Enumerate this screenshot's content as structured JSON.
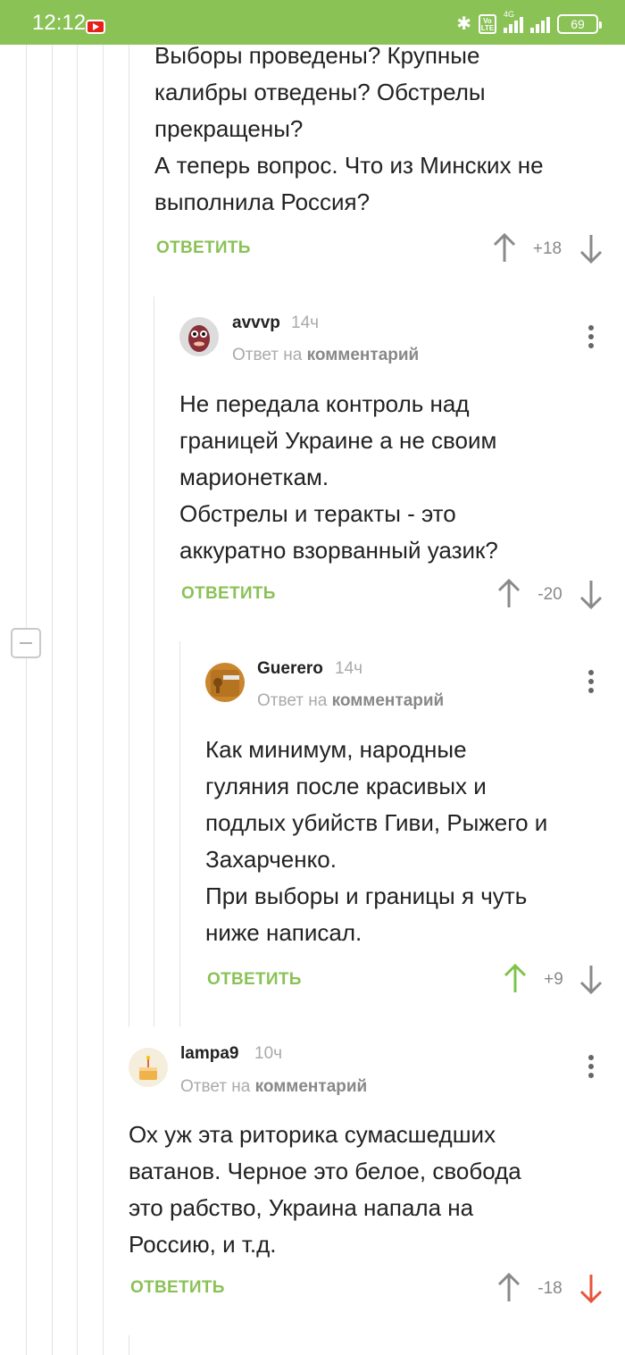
{
  "status_bar": {
    "time": "12:12",
    "battery": "69",
    "network": "4G",
    "volte": "Vo LTE"
  },
  "colors": {
    "status_bar": "#8ac256",
    "reply_link": "#8ac256",
    "upvote_active": "#7cc44a",
    "downvote_active": "#e8543b",
    "vote_inactive": "#8a8a8a"
  },
  "comments": [
    {
      "id": "c0",
      "text_lines": [
        "Выборы проведены? Крупные",
        "калибры отведены? Обстрелы",
        "прекращены?",
        "А теперь вопрос. Что из Минских не",
        "выполнила Россия?"
      ],
      "reply_label": "ОТВЕТИТЬ",
      "score": "+18",
      "vote": "none"
    },
    {
      "id": "c1",
      "username": "avvvp",
      "time": "14ч",
      "reply_to_prefix": "Ответ на",
      "reply_to_link": "комментарий",
      "avatar_icon": "avatar-puppet",
      "text_lines": [
        "Не передала контроль над",
        "границей Украине а не своим",
        "марионеткам.",
        "Обстрелы и теракты - это",
        "аккуратно взорванный уазик?"
      ],
      "reply_label": "ОТВЕТИТЬ",
      "score": "-20",
      "vote": "none"
    },
    {
      "id": "c2",
      "username": "Guerero",
      "time": "14ч",
      "reply_to_prefix": "Ответ на",
      "reply_to_link": "комментарий",
      "avatar_icon": "avatar-key-lock",
      "text_lines": [
        "Как минимум, народные",
        "гуляния после красивых и",
        "подлых убийств Гиви, Рыжего и",
        "Захарченко.",
        "При выборы и границы я чуть",
        "ниже написал."
      ],
      "reply_label": "ОТВЕТИТЬ",
      "score": "+9",
      "vote": "up"
    },
    {
      "id": "c3",
      "username": "lampa9",
      "time": "10ч",
      "reply_to_prefix": "Ответ на",
      "reply_to_link": "комментарий",
      "avatar_icon": "avatar-cake",
      "text_lines": [
        "Ох уж эта риторика сумасшедших",
        "ватанов. Черное это белое, свобода",
        "это рабство, Украина напала на",
        "Россию, и т.д."
      ],
      "reply_label": "ОТВЕТИТЬ",
      "score": "-18",
      "vote": "down"
    }
  ]
}
